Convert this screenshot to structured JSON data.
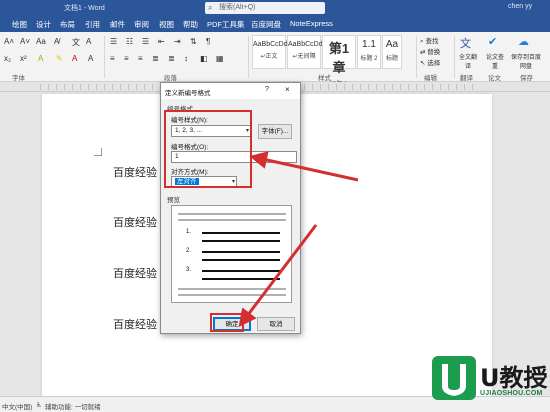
{
  "window": {
    "doc_title": "文档1 - Word",
    "search_placeholder": "搜索(Alt+Q)",
    "user_name": "chen yy"
  },
  "menu_tabs": [
    "绘图",
    "设计",
    "布局",
    "引用",
    "邮件",
    "审阅",
    "视图",
    "帮助",
    "PDF工具集",
    "百度网盘",
    "NoteExpress"
  ],
  "ribbon": {
    "group_labels": [
      "字体",
      "段落",
      "样式",
      "编辑",
      "翻译",
      "论文",
      "保存"
    ],
    "styles": [
      {
        "sample": "AaBbCcDd",
        "name": "↵正文"
      },
      {
        "sample": "AaBbCcDd",
        "name": "↵无间隔"
      },
      {
        "sample": "第1章",
        "name": "标题 1"
      },
      {
        "sample": "1.1",
        "name": "标题 2"
      },
      {
        "sample": "Aa",
        "name": "标题"
      }
    ],
    "right_tools": {
      "find": "查找",
      "replace": "替换",
      "select": "选择",
      "translate": "全文翻译",
      "paper_check": "论文查重",
      "save_to": "保存到百度网盘"
    }
  },
  "document": {
    "paragraphs": [
      "百度经验",
      "百度经验",
      "百度经验",
      "百度经验"
    ]
  },
  "dialog": {
    "title": "定义新编号格式",
    "help": "?",
    "close": "×",
    "section_format": "编号格式",
    "label_style": "编号样式(N):",
    "style_value": "1, 2, 3, ...",
    "font_button": "字体(F)...",
    "label_format": "编号格式(O):",
    "format_value": "1",
    "label_align": "对齐方式(M):",
    "align_value": "左对齐",
    "section_preview": "预览",
    "preview_numbers": [
      "1.",
      "2.",
      "3."
    ],
    "ok_button": "确定",
    "cancel_button": "取消"
  },
  "statusbar": {
    "language": "中文(中国)",
    "accessibility": "辅助功能: 一切就绪"
  },
  "watermark": {
    "brand": "U教授",
    "url": "UJIAOSHOU.COM"
  },
  "colors": {
    "accent": "#2b579a",
    "annotation_red": "#d32f2f",
    "watermark_green": "#1b9c4e"
  }
}
